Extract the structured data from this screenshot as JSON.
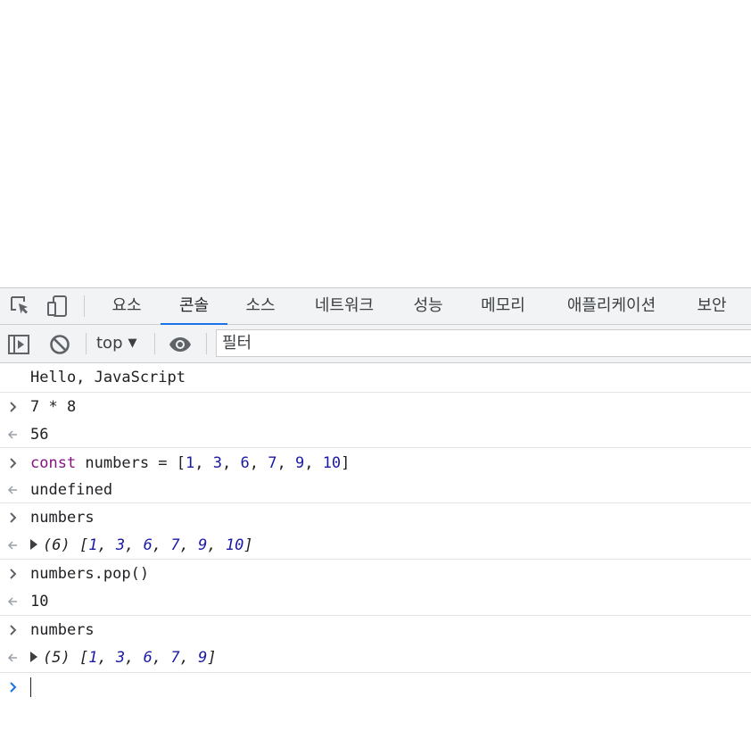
{
  "tabs": [
    "요소",
    "콘솔",
    "소스",
    "네트워크",
    "성능",
    "메모리",
    "애플리케이션",
    "보안"
  ],
  "active_tab": "콘솔",
  "toolbar": {
    "context": "top",
    "filter_placeholder": "필터"
  },
  "console": {
    "log_message": "Hello, JavaScript",
    "entries": [
      {
        "input": "7 * 8",
        "output": "56"
      },
      {
        "input": "const numbers = [1, 3, 6, 7, 9, 10]",
        "output": "undefined"
      },
      {
        "input": "numbers",
        "output": "(6) [1, 3, 6, 7, 9, 10]"
      },
      {
        "input": "numbers.pop()",
        "output": "10"
      },
      {
        "input": "numbers",
        "output": "(5) [1, 3, 6, 7, 9]"
      }
    ]
  },
  "colors": {
    "accent": "#1a73e8",
    "number": "#1a1aa6",
    "keyword": "#881280",
    "undefined": "#80868b"
  }
}
